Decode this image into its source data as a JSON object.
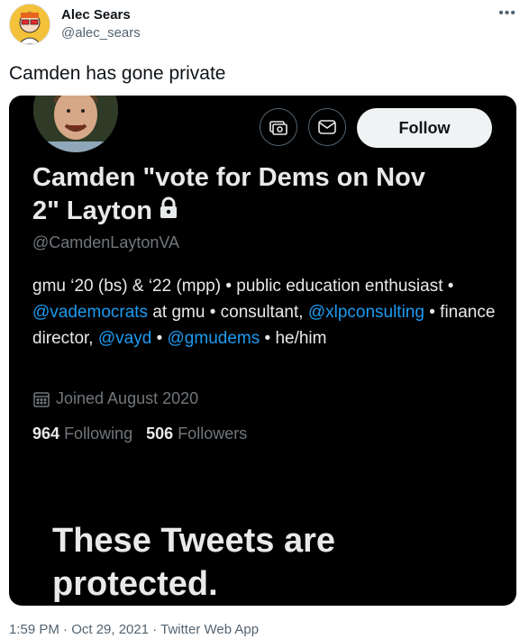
{
  "tweet": {
    "author_name": "Alec Sears",
    "author_handle": "@alec_sears",
    "more_icon": "ellipsis-icon",
    "text": "Camden has gone private",
    "meta": "1:59 PM · Oct 29, 2021 · Twitter Web App"
  },
  "profile": {
    "name_line1": "Camden \"vote for Dems on Nov",
    "name_line2": "2\" Layton",
    "lock_icon": "lock-icon",
    "handle": "@CamdenLaytonVA",
    "follow_label": "Follow",
    "bio": {
      "p1": "gmu ‘20 (bs) & ‘22 (mpp) • public education enthusiast • ",
      "m1": "@vademocrats",
      "p2": " at gmu • consultant, ",
      "m2": "@xlpconsulting",
      "p3": " • finance director, ",
      "m3": "@vayd",
      "p4": " • ",
      "m4": "@gmudems",
      "p5": " • he/him"
    },
    "joined": "Joined August 2020",
    "following_count": "964",
    "following_label": "Following",
    "followers_count": "506",
    "followers_label": "Followers",
    "protected_text": "These Tweets are protected.",
    "link_color": "#1d9bf0"
  }
}
